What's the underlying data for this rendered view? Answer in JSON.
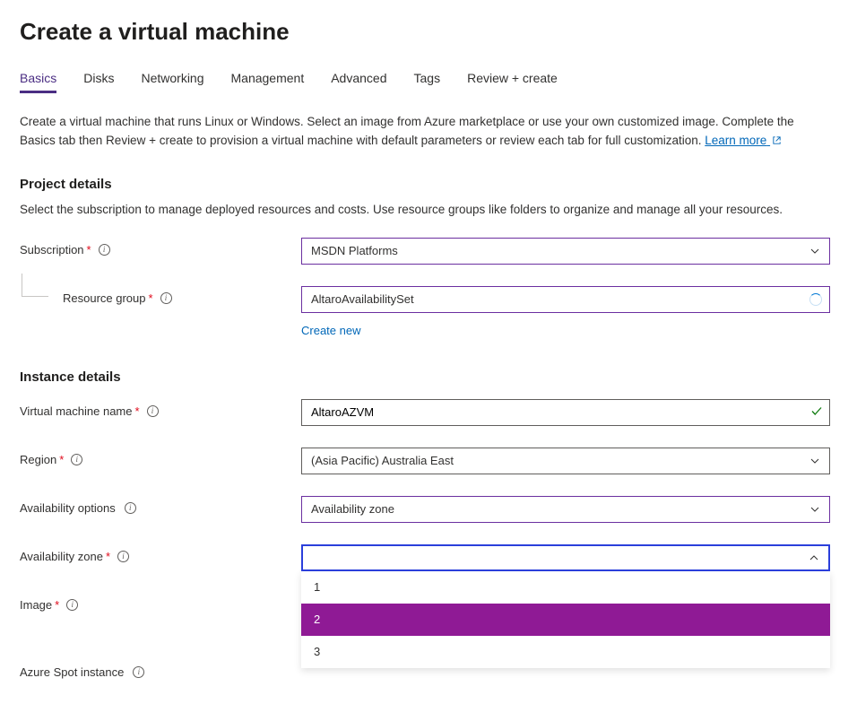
{
  "page": {
    "title": "Create a virtual machine",
    "intro_text": "Create a virtual machine that runs Linux or Windows. Select an image from Azure marketplace or use your own customized image. Complete the Basics tab then Review + create to provision a virtual machine with default parameters or review each tab for full customization. ",
    "learn_more": "Learn more"
  },
  "tabs": {
    "basics": "Basics",
    "disks": "Disks",
    "networking": "Networking",
    "management": "Management",
    "advanced": "Advanced",
    "tags": "Tags",
    "review": "Review + create"
  },
  "project_details": {
    "heading": "Project details",
    "desc": "Select the subscription to manage deployed resources and costs. Use resource groups like folders to organize and manage all your resources.",
    "subscription_label": "Subscription",
    "subscription_value": "MSDN Platforms",
    "resource_group_label": "Resource group",
    "resource_group_value": "AltaroAvailabilitySet",
    "create_new": "Create new"
  },
  "instance_details": {
    "heading": "Instance details",
    "vm_name_label": "Virtual machine name",
    "vm_name_value": "AltaroAZVM",
    "region_label": "Region",
    "region_value": "(Asia Pacific) Australia East",
    "avail_options_label": "Availability options",
    "avail_options_value": "Availability zone",
    "avail_zone_label": "Availability zone",
    "avail_zone_value": "",
    "avail_zone_options": {
      "o1": "1",
      "o2": "2",
      "o3": "3"
    },
    "image_label": "Image",
    "spot_label": "Azure Spot instance"
  }
}
